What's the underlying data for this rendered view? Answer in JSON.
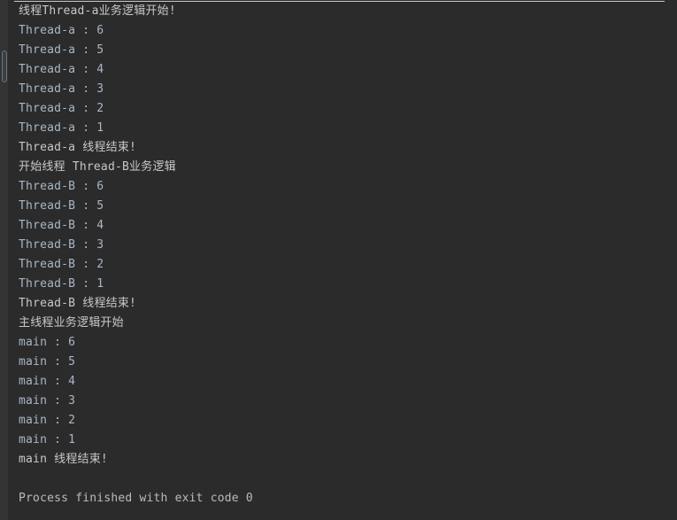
{
  "window": {
    "title": "Run Console Output",
    "background_color": "#2b2b2b",
    "text_color": "#a9b7c6",
    "cjk_text_color": "#c8c8c8",
    "divider_color": "#c8c8c8",
    "gutter_color": "#313335"
  },
  "gutter": {
    "handle_label": ""
  },
  "console": {
    "lines": [
      {
        "id": "l01",
        "kind": "mixed",
        "text": "线程Thread-a业务逻辑开始!"
      },
      {
        "id": "l02",
        "kind": "ascii",
        "text": "Thread-a : 6"
      },
      {
        "id": "l03",
        "kind": "ascii",
        "text": "Thread-a : 5"
      },
      {
        "id": "l04",
        "kind": "ascii",
        "text": "Thread-a : 4"
      },
      {
        "id": "l05",
        "kind": "ascii",
        "text": "Thread-a : 3"
      },
      {
        "id": "l06",
        "kind": "ascii",
        "text": "Thread-a : 2"
      },
      {
        "id": "l07",
        "kind": "ascii",
        "text": "Thread-a : 1"
      },
      {
        "id": "l08",
        "kind": "mixed",
        "text": "Thread-a 线程结束!"
      },
      {
        "id": "l09",
        "kind": "mixed",
        "text": "开始线程 Thread-B业务逻辑"
      },
      {
        "id": "l10",
        "kind": "ascii",
        "text": "Thread-B : 6"
      },
      {
        "id": "l11",
        "kind": "ascii",
        "text": "Thread-B : 5"
      },
      {
        "id": "l12",
        "kind": "ascii",
        "text": "Thread-B : 4"
      },
      {
        "id": "l13",
        "kind": "ascii",
        "text": "Thread-B : 3"
      },
      {
        "id": "l14",
        "kind": "ascii",
        "text": "Thread-B : 2"
      },
      {
        "id": "l15",
        "kind": "ascii",
        "text": "Thread-B : 1"
      },
      {
        "id": "l16",
        "kind": "mixed",
        "text": "Thread-B 线程结束!"
      },
      {
        "id": "l17",
        "kind": "cjk",
        "text": "主线程业务逻辑开始"
      },
      {
        "id": "l18",
        "kind": "ascii",
        "text": "main : 6"
      },
      {
        "id": "l19",
        "kind": "ascii",
        "text": "main : 5"
      },
      {
        "id": "l20",
        "kind": "ascii",
        "text": "main : 4"
      },
      {
        "id": "l21",
        "kind": "ascii",
        "text": "main : 3"
      },
      {
        "id": "l22",
        "kind": "ascii",
        "text": "main : 2"
      },
      {
        "id": "l23",
        "kind": "ascii",
        "text": "main : 1"
      },
      {
        "id": "l24",
        "kind": "mixed",
        "text": "main 线程结束!"
      },
      {
        "id": "l25",
        "kind": "blank",
        "text": ""
      },
      {
        "id": "l26",
        "kind": "result",
        "text": "Process finished with exit code 0"
      }
    ],
    "exit_code": "0",
    "status_text": "Process finished with exit code 0"
  }
}
